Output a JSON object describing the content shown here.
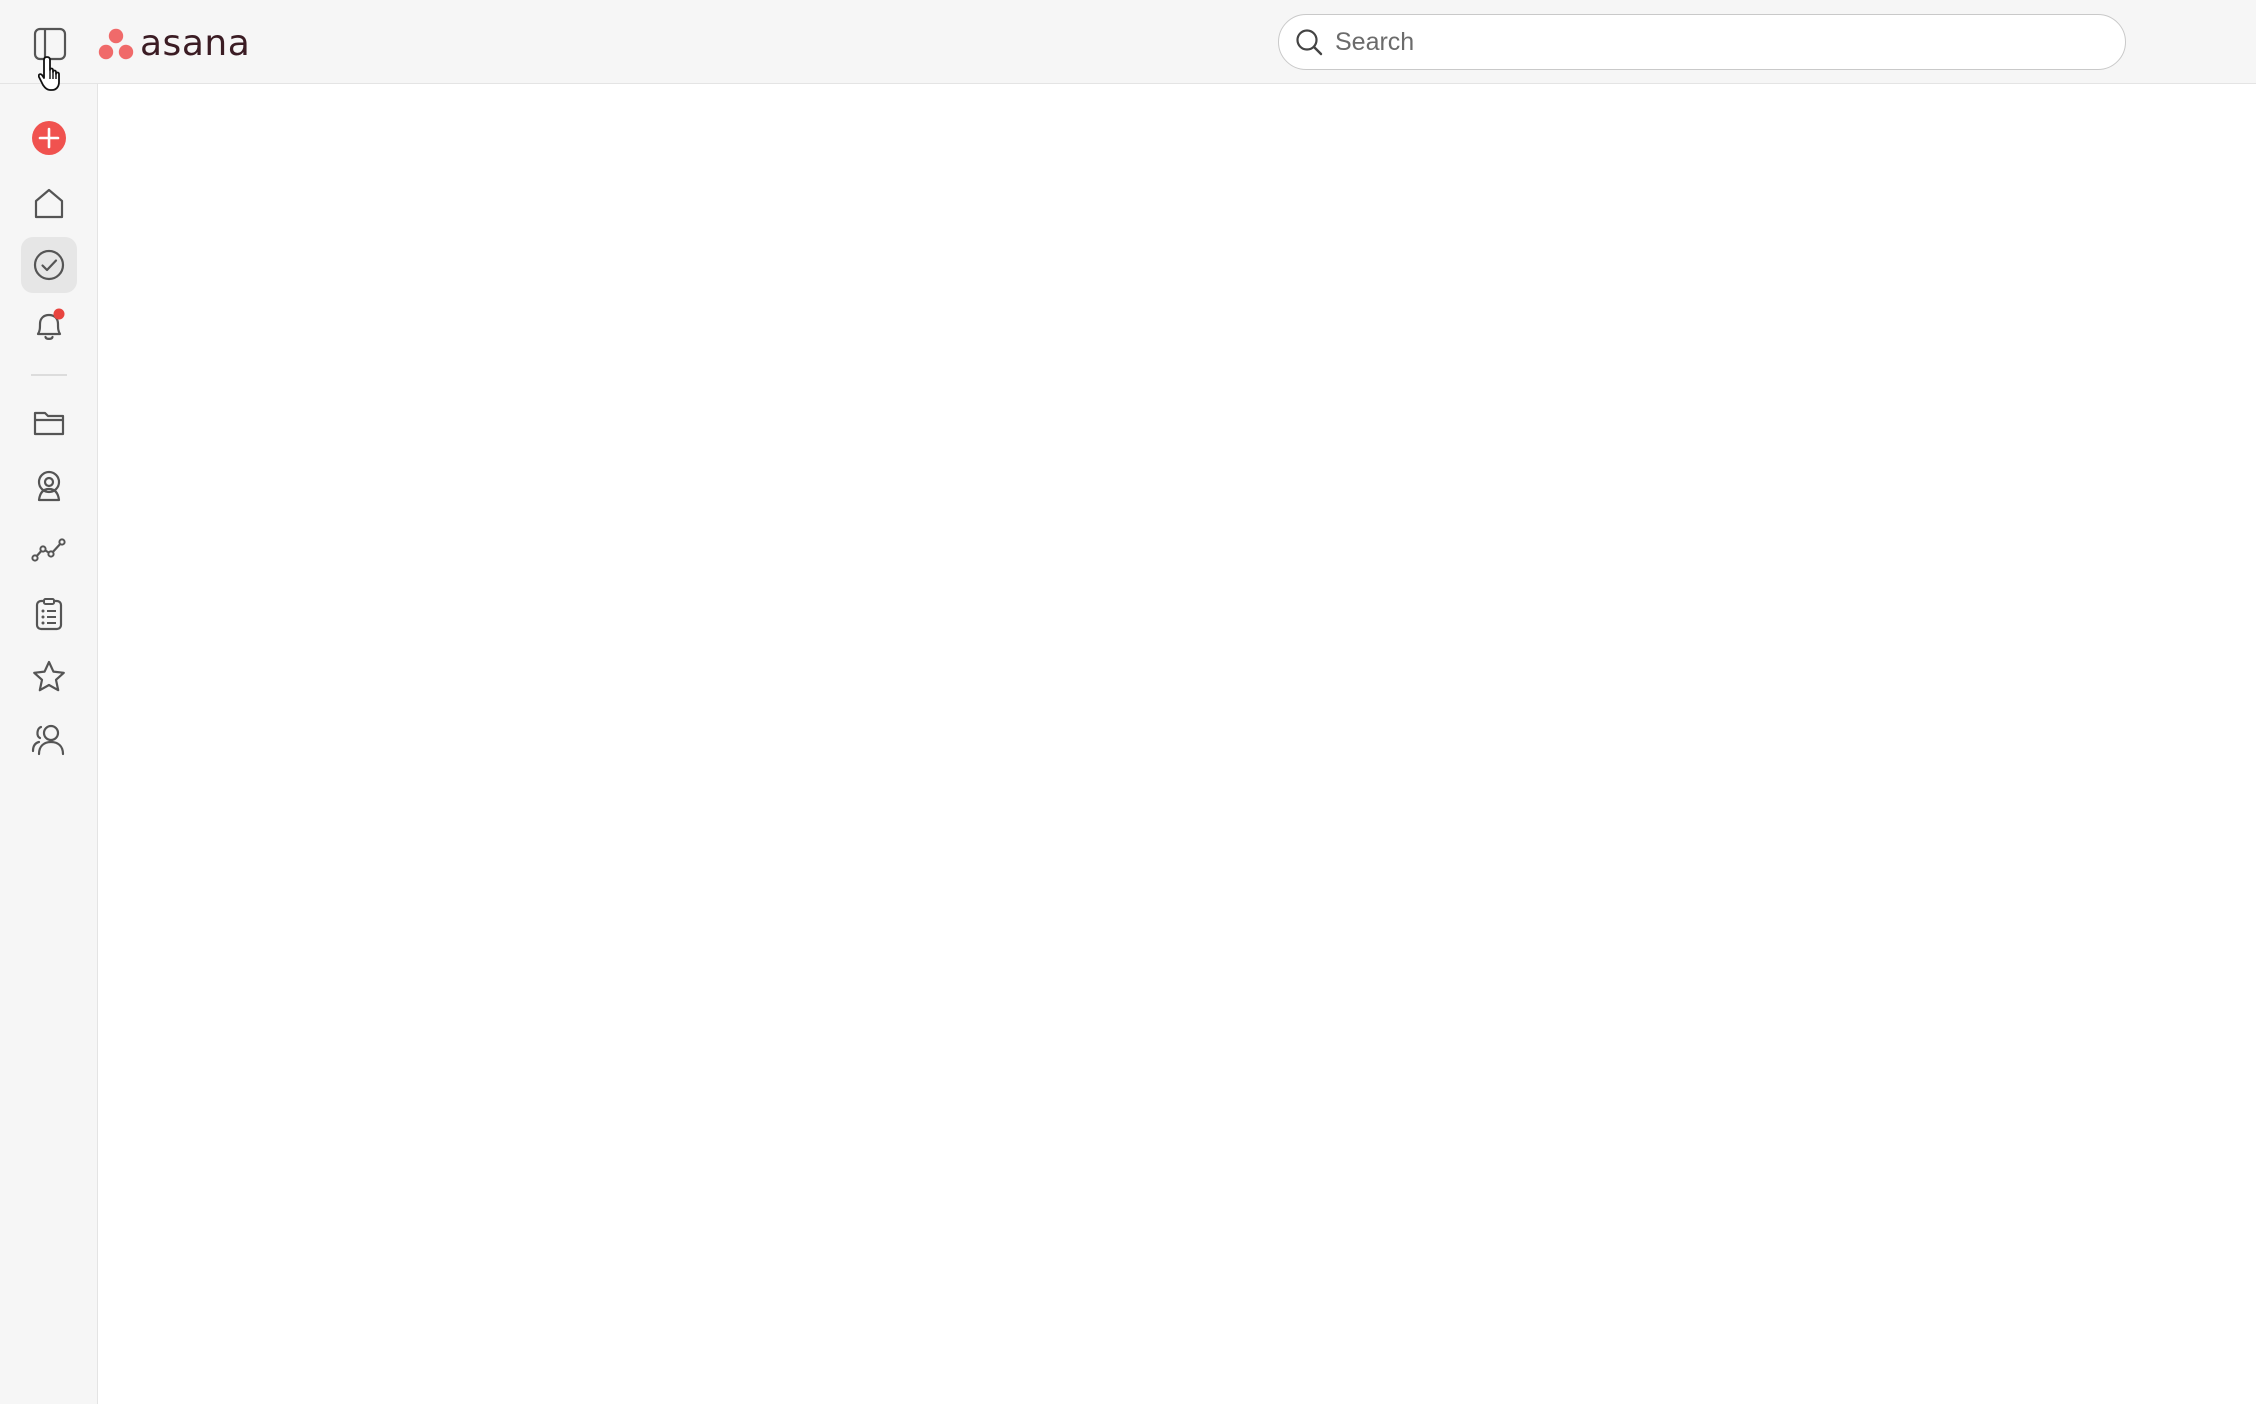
{
  "app": {
    "brand_name": "asana",
    "brand_color": "#f06a6a"
  },
  "topbar": {
    "toggle_icon": "sidebar-toggle-icon",
    "search": {
      "placeholder": "Search",
      "value": ""
    }
  },
  "sidebar": {
    "items": [
      {
        "icon": "plus-circle-icon",
        "name": "create",
        "active": false
      },
      {
        "icon": "home-icon",
        "name": "home",
        "active": false
      },
      {
        "icon": "check-circle-icon",
        "name": "my-tasks",
        "active": true
      },
      {
        "icon": "bell-icon",
        "name": "inbox",
        "active": false,
        "has_notification": true
      },
      {
        "icon": "folder-icon",
        "name": "projects",
        "active": false
      },
      {
        "icon": "portfolio-icon",
        "name": "portfolios",
        "active": false
      },
      {
        "icon": "reporting-icon",
        "name": "reporting",
        "active": false
      },
      {
        "icon": "goals-clipboard-icon",
        "name": "goals",
        "active": false
      },
      {
        "icon": "star-icon",
        "name": "favorites",
        "active": false
      },
      {
        "icon": "team-icon",
        "name": "teams",
        "active": false
      }
    ]
  }
}
